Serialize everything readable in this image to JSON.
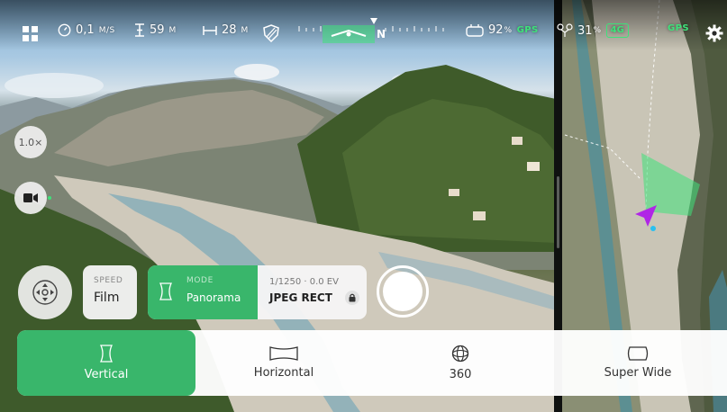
{
  "statusbar": {
    "speed": "0,1",
    "speed_unit": "M/S",
    "altitude": "59",
    "altitude_unit": "M",
    "distance": "28",
    "distance_unit": "M",
    "compass_heading": "N",
    "controller_battery": "92",
    "controller_battery_unit": "%",
    "controller_gps": "GPS",
    "drone_battery": "31",
    "drone_battery_unit": "%",
    "network": "4G",
    "drone_gps": "GPS"
  },
  "left_controls": {
    "zoom_label": "1.0×"
  },
  "speed_card": {
    "label": "SPEED",
    "value": "Film"
  },
  "mode_card": {
    "label": "MODE",
    "value": "Panorama",
    "exposure": "1/1250 · 0.0 EV",
    "format": "JPEG RECT"
  },
  "panorama_tabs": [
    {
      "label": "Vertical",
      "icon": "vertical-pano-icon",
      "active": true
    },
    {
      "label": "Horizontal",
      "icon": "horizontal-pano-icon",
      "active": false
    },
    {
      "label": "360",
      "icon": "sphere-icon",
      "active": false
    },
    {
      "label": "Super Wide",
      "icon": "superwide-icon",
      "active": false
    }
  ],
  "colors": {
    "accent": "#39b66b",
    "gps": "#3ee27a",
    "drone_marker": "#b026e6"
  }
}
